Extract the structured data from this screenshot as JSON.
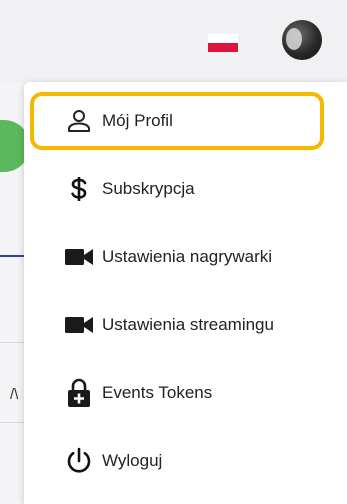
{
  "header": {
    "language_flag": "poland-flag-icon",
    "avatar": "user-avatar"
  },
  "background": {
    "partial_text": "/\\"
  },
  "menu": {
    "items": [
      {
        "label": "Mój Profil",
        "icon": "user-icon"
      },
      {
        "label": "Subskrypcja",
        "icon": "dollar-icon"
      },
      {
        "label": "Ustawienia nagrywarki",
        "icon": "video-camera-icon"
      },
      {
        "label": "Ustawienia streamingu",
        "icon": "video-camera-icon"
      },
      {
        "label": "Events Tokens",
        "icon": "lock-plus-icon"
      },
      {
        "label": "Wyloguj",
        "icon": "power-icon"
      }
    ],
    "highlighted_index": 0
  },
  "colors": {
    "highlight": "#f5b800",
    "flag_red": "#dc143c",
    "text": "#222222"
  }
}
